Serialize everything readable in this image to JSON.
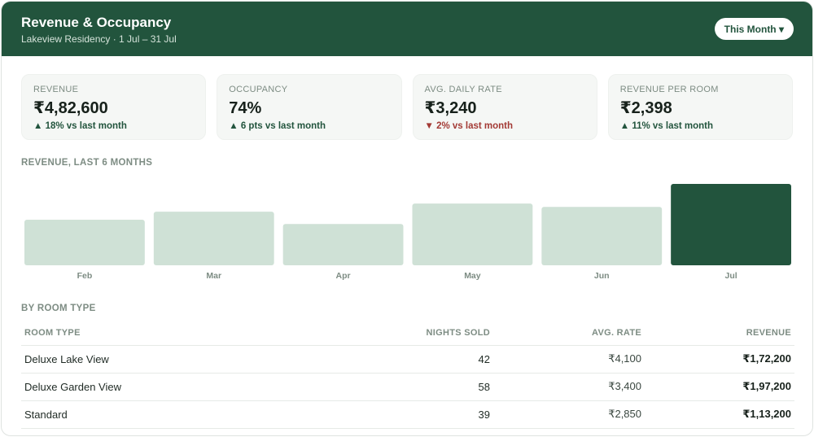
{
  "header": {
    "title": "Revenue & Occupancy",
    "subtitle": "Lakeview Residency · 1 Jul – 31 Jul",
    "period_button": "This Month ▾"
  },
  "kpis": [
    {
      "label": "REVENUE",
      "value": "₹4,82,600",
      "delta": "▲ 18% vs last month",
      "trend": "up"
    },
    {
      "label": "OCCUPANCY",
      "value": "74%",
      "delta": "▲ 6 pts vs last month",
      "trend": "up"
    },
    {
      "label": "AVG. DAILY RATE",
      "value": "₹3,240",
      "delta": "▼ 2% vs last month",
      "trend": "down"
    },
    {
      "label": "REVENUE PER ROOM",
      "value": "₹2,398",
      "delta": "▲ 11% vs last month",
      "trend": "up"
    }
  ],
  "chart_section_title": "REVENUE, LAST 6 MONTHS",
  "chart_data": {
    "type": "bar",
    "categories": [
      "Feb",
      "Mar",
      "Apr",
      "May",
      "Jun",
      "Jul"
    ],
    "values": [
      270000,
      318000,
      245000,
      366000,
      346000,
      482600
    ],
    "title": "REVENUE, LAST 6 MONTHS",
    "xlabel": "",
    "ylabel": "",
    "ylim": [
      0,
      482600
    ],
    "grid": false,
    "highlight_index": 5,
    "colors": {
      "bar": "#cfe1d6",
      "highlight": "#22543d",
      "tick": "#7d8c83"
    }
  },
  "table_section_title": "BY ROOM TYPE",
  "table": {
    "headers": [
      "ROOM TYPE",
      "NIGHTS SOLD",
      "AVG. RATE",
      "REVENUE"
    ],
    "rows": [
      [
        "Deluxe Lake View",
        "42",
        "₹4,100",
        "₹1,72,200"
      ],
      [
        "Deluxe Garden View",
        "58",
        "₹3,400",
        "₹1,97,200"
      ],
      [
        "Standard",
        "39",
        "₹2,850",
        "₹1,13,200"
      ]
    ]
  },
  "colors": {
    "accent": "#22543d",
    "positive": "#22543d",
    "negative": "#a33a35"
  }
}
